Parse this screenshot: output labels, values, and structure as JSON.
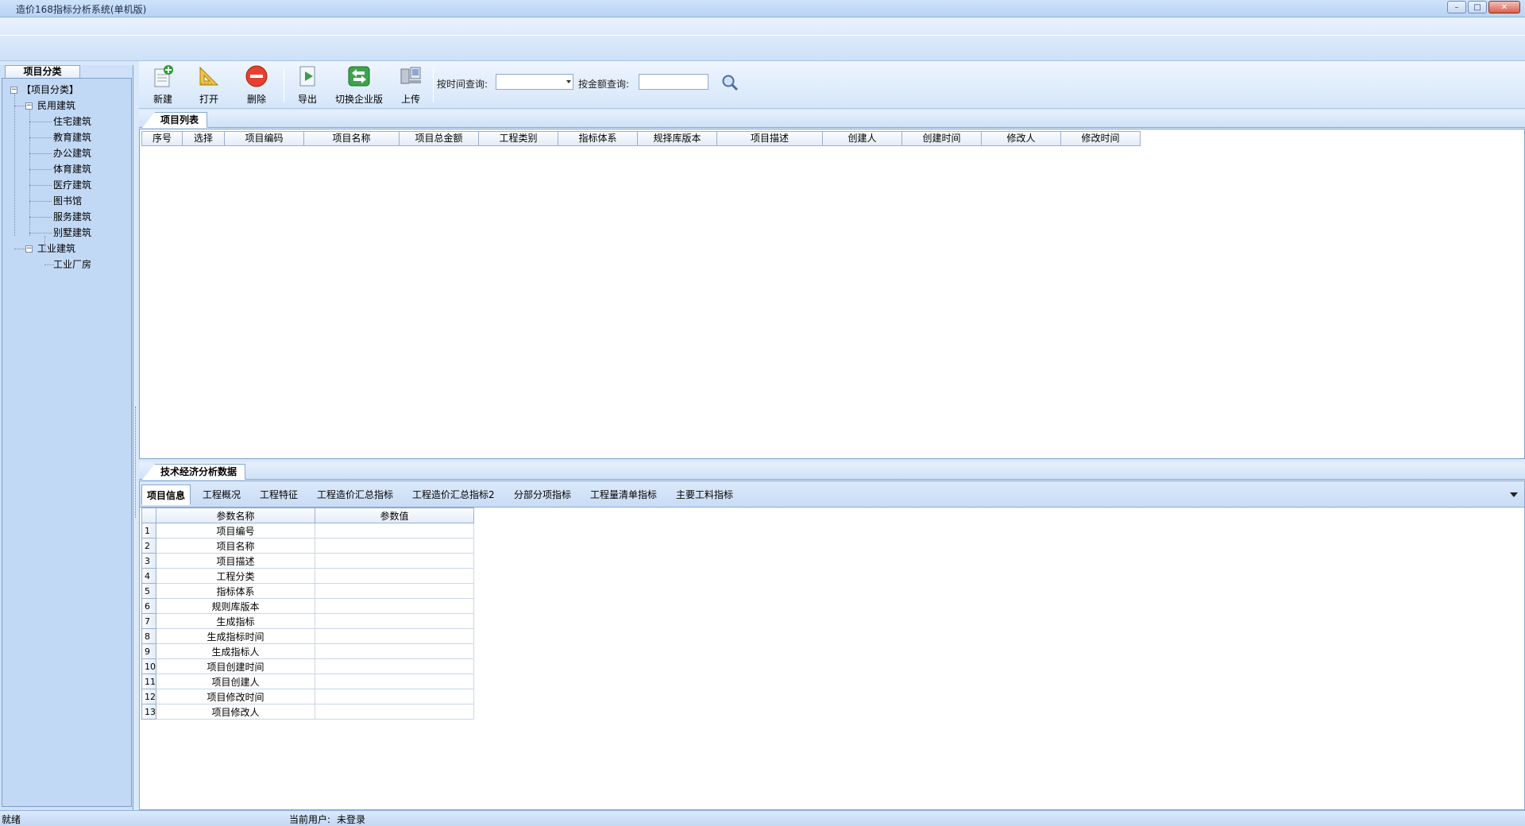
{
  "window": {
    "title": "造价168指标分析系统(单机版)",
    "controls": [
      "minimize-icon",
      "maximize-icon",
      "close-icon"
    ]
  },
  "left_panel": {
    "tab_label": "项目分类",
    "tree": {
      "root": "【项目分类】",
      "groups": [
        {
          "label": "民用建筑",
          "children": [
            "住宅建筑",
            "教育建筑",
            "办公建筑",
            "体育建筑",
            "医疗建筑",
            "图书馆",
            "服务建筑",
            "别墅建筑"
          ]
        },
        {
          "label": "工业建筑",
          "children": [
            "工业厂房"
          ]
        }
      ]
    }
  },
  "toolbar": {
    "buttons": [
      {
        "label": "新建",
        "icon": "new-document-icon"
      },
      {
        "label": "打开",
        "icon": "open-ruler-icon"
      },
      {
        "label": "删除",
        "icon": "delete-icon"
      },
      {
        "label": "导出",
        "icon": "export-icon"
      },
      {
        "label": "切换企业版",
        "icon": "switch-arrows-icon"
      },
      {
        "label": "上传",
        "icon": "upload-icon"
      }
    ],
    "time_query_label": "按时间查询:",
    "time_query_value": "",
    "amount_query_label": "按金额查询:",
    "amount_query_value": "",
    "search_icon": "search-icon"
  },
  "project_list": {
    "tab_label": "项目列表",
    "columns": [
      "序号",
      "选择",
      "项目编码",
      "项目名称",
      "项目总金额",
      "工程类别",
      "指标体系",
      "规择库版本",
      "项目描述",
      "创建人",
      "创建时间",
      "修改人",
      "修改时间"
    ],
    "rows": []
  },
  "analysis": {
    "section_label": "技术经济分析数据",
    "tabs": [
      "项目信息",
      "工程概况",
      "工程特征",
      "工程造价汇总指标",
      "工程造价汇总指标2",
      "分部分项指标",
      "工程量清单指标",
      "主要工料指标"
    ],
    "active_tab": "项目信息",
    "param_table": {
      "headers": [
        "参数名称",
        "参数值"
      ],
      "rows": [
        {
          "n": "1",
          "name": "项目编号",
          "value": ""
        },
        {
          "n": "2",
          "name": "项目名称",
          "value": ""
        },
        {
          "n": "3",
          "name": "项目描述",
          "value": ""
        },
        {
          "n": "4",
          "name": "工程分类",
          "value": ""
        },
        {
          "n": "5",
          "name": "指标体系",
          "value": ""
        },
        {
          "n": "6",
          "name": "规则库版本",
          "value": ""
        },
        {
          "n": "7",
          "name": "生成指标",
          "value": ""
        },
        {
          "n": "8",
          "name": "生成指标时间",
          "value": ""
        },
        {
          "n": "9",
          "name": "生成指标人",
          "value": ""
        },
        {
          "n": "10",
          "name": "项目创建时间",
          "value": ""
        },
        {
          "n": "11",
          "name": "项目创建人",
          "value": ""
        },
        {
          "n": "12",
          "name": "项目修改时间",
          "value": ""
        },
        {
          "n": "13",
          "name": "项目修改人",
          "value": ""
        }
      ]
    }
  },
  "status_bar": {
    "state": "就绪",
    "user_label": "当前用户:",
    "user_value": "未登录"
  }
}
